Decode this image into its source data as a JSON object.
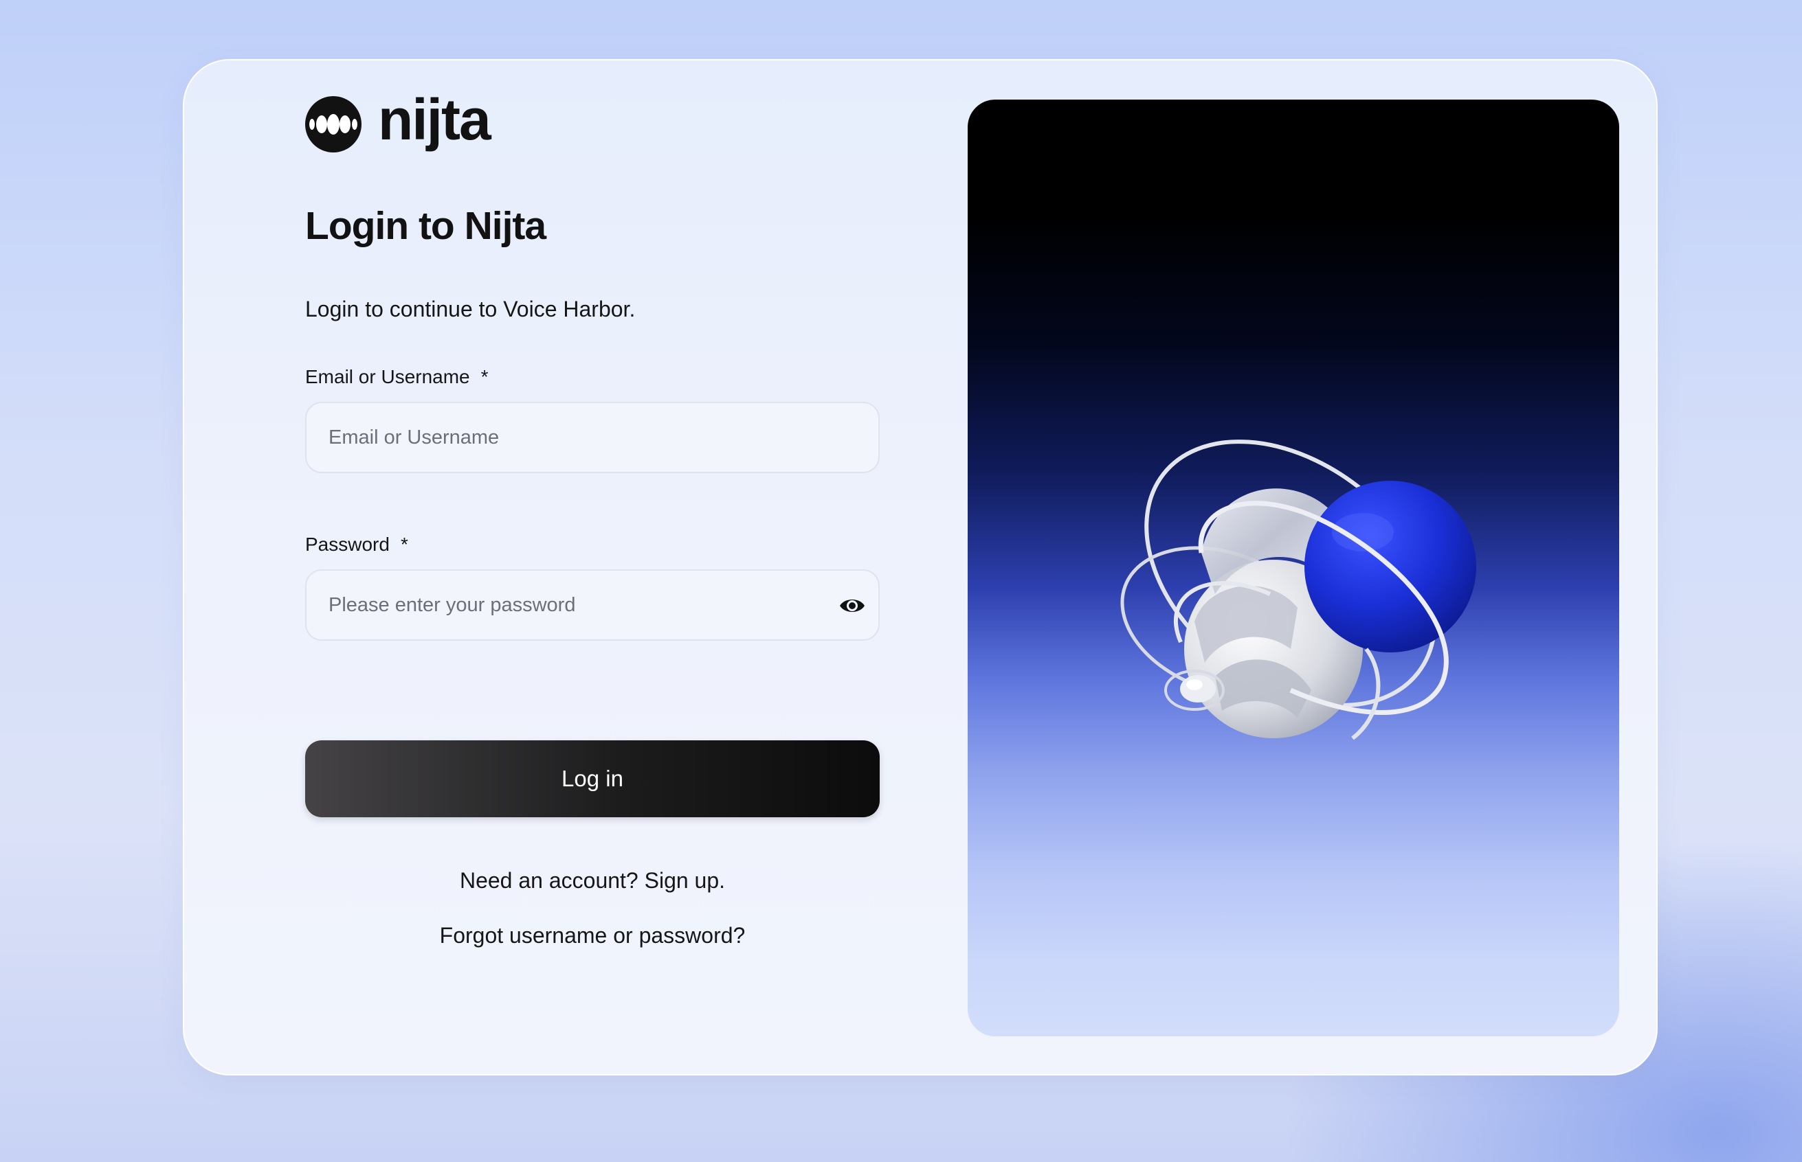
{
  "brand": {
    "name": "nijta",
    "logo_icon": "nijta-logo-icon"
  },
  "login": {
    "title": "Login to Nijta",
    "subtitle": "Login to continue to Voice Harbor.",
    "email_label": "Email or Username",
    "email_placeholder": "Email or Username",
    "email_value": "",
    "password_label": "Password",
    "password_placeholder": "Please enter your password",
    "password_value": "",
    "required_marker": "*",
    "password_toggle_icon": "eye-icon",
    "login_button": "Log in",
    "signup_link": "Need an account? Sign up.",
    "forgot_link": "Forgot username or password?"
  },
  "hero": {
    "illustration": "3d-orbiting-sphere-illustration",
    "colors": {
      "sphere_blue": "#1a2fd6",
      "top_black": "#000000",
      "bottom_light": "#d2ddfb"
    }
  },
  "colors": {
    "button_dark": "#1c1c1d",
    "text": "#161616",
    "card_bg": "#eef2fc"
  }
}
